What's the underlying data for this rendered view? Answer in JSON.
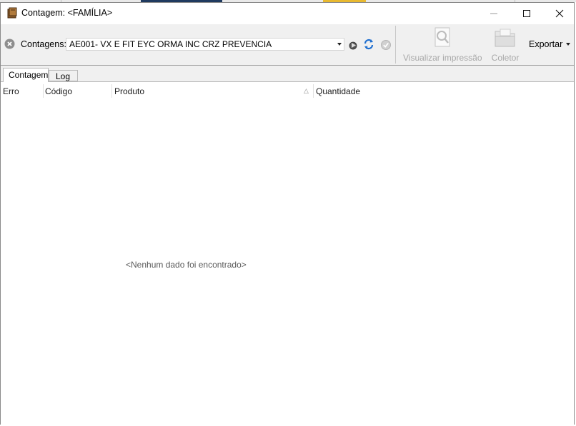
{
  "window": {
    "title": "Contagem: <FAMÍLIA>"
  },
  "toolbar": {
    "combo_label": "Contagens:",
    "combo_value": "AE001- VX E FIT EYC ORMA INC CRZ PREVENCIA",
    "print_preview_label": "Visualizar impressão",
    "collector_label": "Coletor",
    "export_label": "Exportar",
    "icons": [
      "clear-icon",
      "play-icon",
      "refresh-icon",
      "check-icon",
      "magnifier-icon",
      "folder-icon"
    ]
  },
  "tabs": [
    {
      "label": "Contagem",
      "active": true
    },
    {
      "label": "Log",
      "active": false
    }
  ],
  "grid": {
    "columns": [
      "Erro",
      "Código",
      "Produto",
      "Quantidade"
    ],
    "sorted_column": "Produto",
    "empty_message": "<Nenhum dado foi encontrado>"
  },
  "colors": {
    "toolbar_bg": "#f0f0f0",
    "refresh_blue": "#1f6fd0",
    "disabled_text": "#a8a8a8"
  }
}
